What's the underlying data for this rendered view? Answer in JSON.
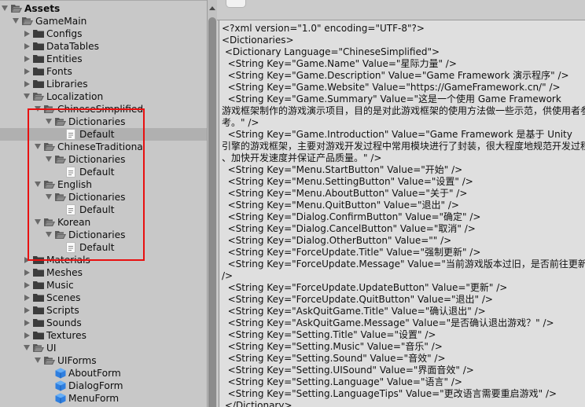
{
  "project_panel": {
    "items": [
      {
        "label": "Assets",
        "depth": 0,
        "expanded": true,
        "type": "folder-open",
        "bold": true
      },
      {
        "label": "GameMain",
        "depth": 1,
        "expanded": true,
        "type": "folder-open"
      },
      {
        "label": "Configs",
        "depth": 2,
        "expanded": false,
        "type": "folder"
      },
      {
        "label": "DataTables",
        "depth": 2,
        "expanded": false,
        "type": "folder"
      },
      {
        "label": "Entities",
        "depth": 2,
        "expanded": false,
        "type": "folder"
      },
      {
        "label": "Fonts",
        "depth": 2,
        "expanded": false,
        "type": "folder"
      },
      {
        "label": "Libraries",
        "depth": 2,
        "expanded": false,
        "type": "folder"
      },
      {
        "label": "Localization",
        "depth": 2,
        "expanded": true,
        "type": "folder-open"
      },
      {
        "label": "ChineseSimplified",
        "depth": 3,
        "expanded": true,
        "type": "folder-open"
      },
      {
        "label": "Dictionaries",
        "depth": 4,
        "expanded": true,
        "type": "folder-open"
      },
      {
        "label": "Default",
        "depth": 5,
        "type": "file",
        "selected": true
      },
      {
        "label": "ChineseTraditional",
        "depth": 3,
        "expanded": true,
        "type": "folder-open"
      },
      {
        "label": "Dictionaries",
        "depth": 4,
        "expanded": true,
        "type": "folder-open"
      },
      {
        "label": "Default",
        "depth": 5,
        "type": "file"
      },
      {
        "label": "English",
        "depth": 3,
        "expanded": true,
        "type": "folder-open"
      },
      {
        "label": "Dictionaries",
        "depth": 4,
        "expanded": true,
        "type": "folder-open"
      },
      {
        "label": "Default",
        "depth": 5,
        "type": "file"
      },
      {
        "label": "Korean",
        "depth": 3,
        "expanded": true,
        "type": "folder-open"
      },
      {
        "label": "Dictionaries",
        "depth": 4,
        "expanded": true,
        "type": "folder-open"
      },
      {
        "label": "Default",
        "depth": 5,
        "type": "file"
      },
      {
        "label": "Materials",
        "depth": 2,
        "expanded": false,
        "type": "folder"
      },
      {
        "label": "Meshes",
        "depth": 2,
        "expanded": false,
        "type": "folder"
      },
      {
        "label": "Music",
        "depth": 2,
        "expanded": false,
        "type": "folder"
      },
      {
        "label": "Scenes",
        "depth": 2,
        "expanded": false,
        "type": "folder"
      },
      {
        "label": "Scripts",
        "depth": 2,
        "expanded": false,
        "type": "folder"
      },
      {
        "label": "Sounds",
        "depth": 2,
        "expanded": false,
        "type": "folder"
      },
      {
        "label": "Textures",
        "depth": 2,
        "expanded": false,
        "type": "folder"
      },
      {
        "label": "UI",
        "depth": 2,
        "expanded": true,
        "type": "folder-open"
      },
      {
        "label": "UIForms",
        "depth": 3,
        "expanded": true,
        "type": "folder-open"
      },
      {
        "label": "AboutForm",
        "depth": 4,
        "type": "prefab"
      },
      {
        "label": "DialogForm",
        "depth": 4,
        "type": "prefab"
      },
      {
        "label": "MenuForm",
        "depth": 4,
        "type": "prefab"
      }
    ],
    "highlight_box_color": "#e81010"
  },
  "file_preview": {
    "lines": [
      "<?xml version=\"1.0\" encoding=\"UTF-8\"?>",
      "<Dictionaries>",
      " <Dictionary Language=\"ChineseSimplified\">",
      "  <String Key=\"Game.Name\" Value=\"星际力量\" />",
      "  <String Key=\"Game.Description\" Value=\"Game Framework 演示程序\" />",
      "  <String Key=\"Game.Website\" Value=\"https://GameFramework.cn/\" />",
      "  <String Key=\"Game.Summary\" Value=\"这是一个使用 Game Framework",
      "游戏框架制作的游戏演示项目，目的是对此游戏框架的使用方法做一些示范，供使用者参",
      "考。\" />",
      "  <String Key=\"Game.Introduction\" Value=\"Game Framework 是基于 Unity",
      "引擎的游戏框架，主要对游戏开发过程中常用模块进行了封装，很大程度地规范开发过程",
      "、加快开发速度并保证产品质量。\" />",
      "  <String Key=\"Menu.StartButton\" Value=\"开始\" />",
      "  <String Key=\"Menu.SettingButton\" Value=\"设置\" />",
      "  <String Key=\"Menu.AboutButton\" Value=\"关于\" />",
      "  <String Key=\"Menu.QuitButton\" Value=\"退出\" />",
      "  <String Key=\"Dialog.ConfirmButton\" Value=\"确定\" />",
      "  <String Key=\"Dialog.CancelButton\" Value=\"取消\" />",
      "  <String Key=\"Dialog.OtherButton\" Value=\"\" />",
      "  <String Key=\"ForceUpdate.Title\" Value=\"强制更新\" />",
      "  <String Key=\"ForceUpdate.Message\" Value=\"当前游戏版本过旧，是否前往更新？\"",
      "/>",
      "  <String Key=\"ForceUpdate.UpdateButton\" Value=\"更新\" />",
      "  <String Key=\"ForceUpdate.QuitButton\" Value=\"退出\" />",
      "  <String Key=\"AskQuitGame.Title\" Value=\"确认退出\" />",
      "  <String Key=\"AskQuitGame.Message\" Value=\"是否确认退出游戏？\" />",
      "  <String Key=\"Setting.Title\" Value=\"设置\" />",
      "  <String Key=\"Setting.Music\" Value=\"音乐\" />",
      "  <String Key=\"Setting.Sound\" Value=\"音效\" />",
      "  <String Key=\"Setting.UISound\" Value=\"界面音效\" />",
      "  <String Key=\"Setting.Language\" Value=\"语言\" />",
      "  <String Key=\"Setting.LanguageTips\" Value=\"更改语言需要重启游戏\" />",
      " </Dictionary>"
    ]
  }
}
